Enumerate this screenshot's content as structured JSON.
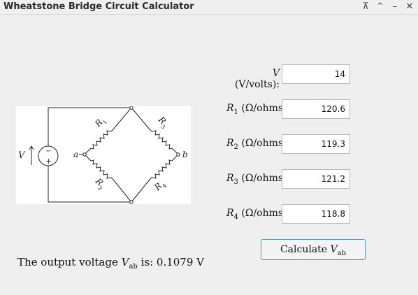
{
  "window": {
    "title": "Wheatstone Bridge Circuit Calculator",
    "buttons": {
      "pin": "⊼",
      "up": "⌃",
      "minimize": "–",
      "close": "✕"
    }
  },
  "inputs": [
    {
      "label_main": "V",
      "label_units": "(V/volts):",
      "value": "14"
    },
    {
      "label_main": "R",
      "label_sub": "1",
      "label_units": "(Ω/ohms):",
      "value": "120.6"
    },
    {
      "label_main": "R",
      "label_sub": "2",
      "label_units": "(Ω/ohms):",
      "value": "119.3"
    },
    {
      "label_main": "R",
      "label_sub": "3",
      "label_units": "(Ω/ohms):",
      "value": "121.2"
    },
    {
      "label_main": "R",
      "label_sub": "4",
      "label_units": "(Ω/ohms):",
      "value": "118.8"
    }
  ],
  "calculate_button": {
    "label_prefix": "Calculate ",
    "label_main": "V",
    "label_sub": "ab"
  },
  "result": {
    "prefix": "The output voltage ",
    "label_main": "V",
    "label_sub": "ab",
    "suffix": " is: 0.1079 V"
  },
  "diagram": {
    "labels": {
      "v": "V",
      "plus": "+",
      "minus": "−",
      "a": "a",
      "b": "b",
      "r1": "R",
      "r2": "R",
      "r3": "R",
      "r4": "R"
    },
    "subs": {
      "r1": "1",
      "r2": "2",
      "r3": "3",
      "r4": "4"
    }
  }
}
